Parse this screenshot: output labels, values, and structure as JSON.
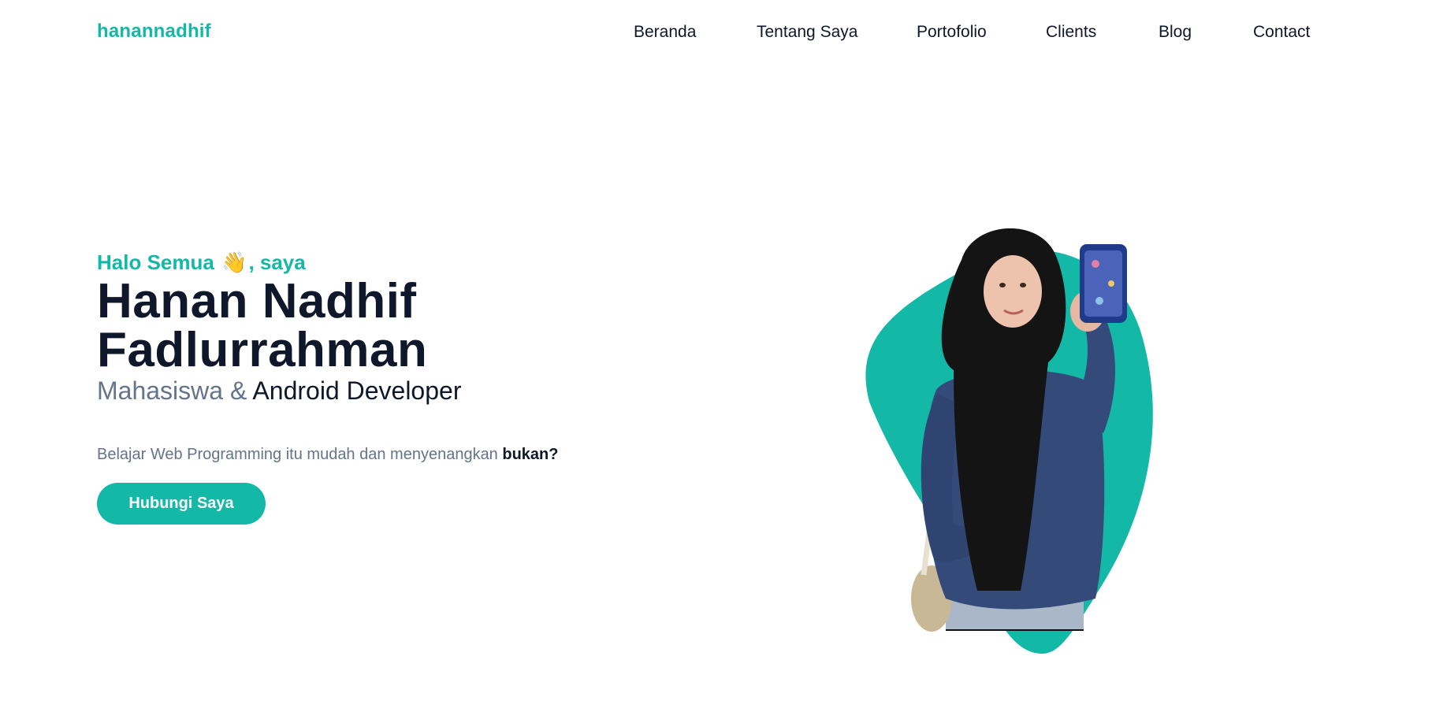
{
  "header": {
    "brand": "hanannadhif",
    "nav": [
      "Beranda",
      "Tentang Saya",
      "Portofolio",
      "Clients",
      "Blog",
      "Contact"
    ]
  },
  "hero": {
    "greeting_prefix": "Halo Semua",
    "greeting_emoji": "👋",
    "greeting_suffix": ", saya",
    "name_line1": "Hanan Nadhif",
    "name_line2": "Fadlurrahman",
    "role_part1": "Mahasiswa & ",
    "role_part2": "Android Developer",
    "tagline_text": "Belajar Web Programming itu mudah dan menyenangkan ",
    "tagline_bold": "bukan?",
    "cta_label": "Hubungi Saya"
  },
  "colors": {
    "accent": "#14b8a6",
    "heading": "#0f172a",
    "muted": "#64748b",
    "jacket": "#344b7a",
    "hijab": "#141414"
  },
  "icons": {
    "greeting": "waving-hand-icon"
  }
}
